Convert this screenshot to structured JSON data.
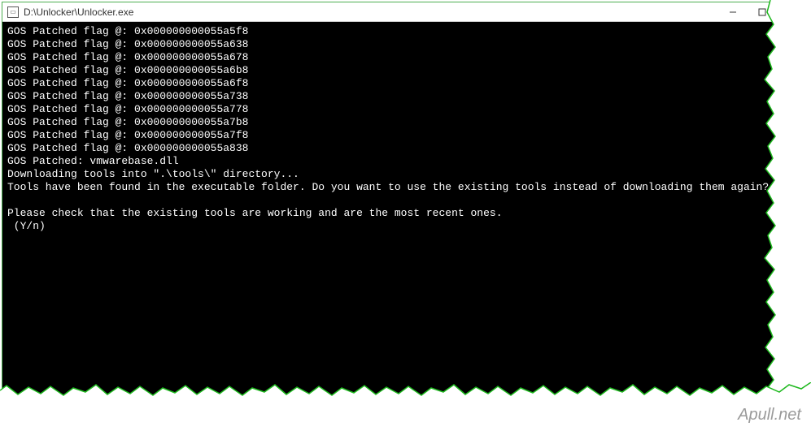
{
  "window": {
    "title": "D:\\Unlocker\\Unlocker.exe"
  },
  "console": {
    "lines": [
      "GOS Patched flag @: 0x000000000055a5f8",
      "GOS Patched flag @: 0x000000000055a638",
      "GOS Patched flag @: 0x000000000055a678",
      "GOS Patched flag @: 0x000000000055a6b8",
      "GOS Patched flag @: 0x000000000055a6f8",
      "GOS Patched flag @: 0x000000000055a738",
      "GOS Patched flag @: 0x000000000055a778",
      "GOS Patched flag @: 0x000000000055a7b8",
      "GOS Patched flag @: 0x000000000055a7f8",
      "GOS Patched flag @: 0x000000000055a838",
      "GOS Patched: vmwarebase.dll",
      "Downloading tools into \".\\tools\\\" directory...",
      "Tools have been found in the executable folder. Do you want to use the existing tools instead of downloading them again?",
      "",
      "Please check that the existing tools are working and are the most recent ones.",
      " (Y/n)"
    ]
  },
  "watermark": "Apull.net"
}
